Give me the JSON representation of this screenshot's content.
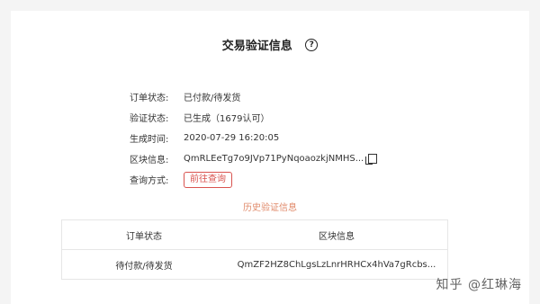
{
  "header": {
    "title": "交易验证信息",
    "help_glyph": "?"
  },
  "details": [
    {
      "label": "订单状态:",
      "value": "已付款/待发货"
    },
    {
      "label": "验证状态:",
      "value": "已生成（1679认可）"
    },
    {
      "label": "生成时间:",
      "value": "2020-07-29 16:20:05"
    },
    {
      "label": "区块信息:",
      "value": "QmRLEeTg7o9JVp71PyNqoaozkjNMHS..."
    },
    {
      "label": "查询方式:",
      "value": "前往查询"
    }
  ],
  "history": {
    "title": "历史验证信息",
    "columns": [
      "订单状态",
      "区块信息"
    ],
    "rows": [
      {
        "status": "待付款/待发货",
        "block": "QmZF2HZ8ChLgsLzLnrHRHCx4hVa7gRcbs..."
      }
    ]
  },
  "watermark": "知乎 @红琳海",
  "colors": {
    "accent": "#d9534f",
    "history_title": "#e08a6a"
  }
}
